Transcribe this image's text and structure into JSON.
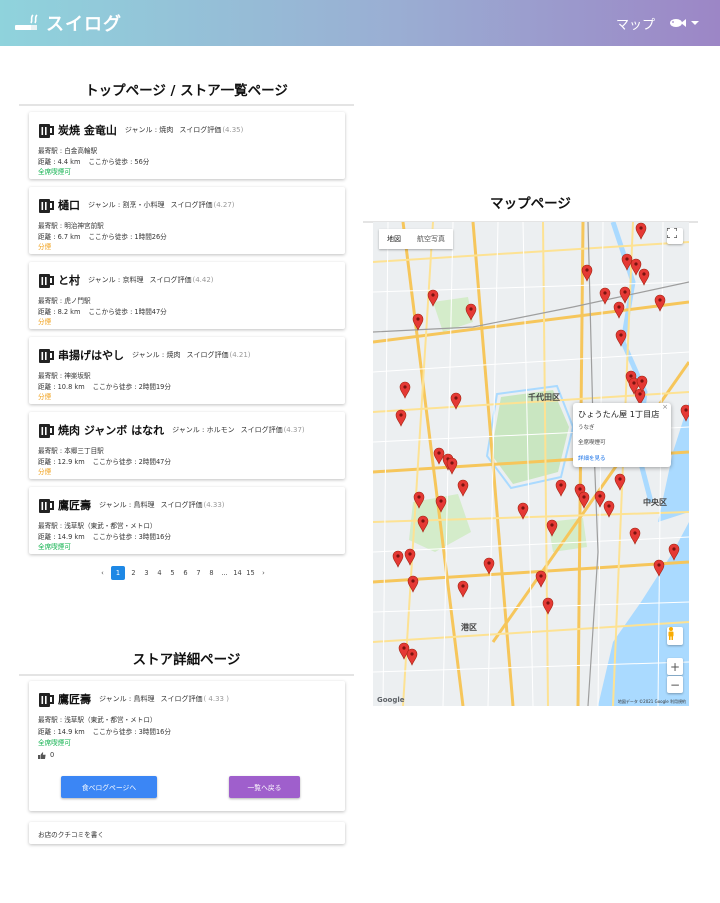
{
  "app": {
    "brand": "スイログ",
    "nav_map": "マップ"
  },
  "top_section": {
    "title": "トップページ / ストア一覧ページ"
  },
  "labels": {
    "genre_prefix": "ジャンル : ",
    "rating_label": "スイログ評価",
    "station_prefix": "最寄駅 : ",
    "distance_prefix": "距離 : ",
    "walk_prefix": "ここから徒歩 : "
  },
  "stores": [
    {
      "name": "炭焼 金竜山",
      "genre": "ジャンル : 焼肉",
      "rating": "(4.35)",
      "station": "最寄駅 : 白金高輪駅",
      "distance": "距離 : 4.4 km",
      "walk": "ここから徒歩 : 56分",
      "smoking": "全席喫煙可",
      "smoking_type": "ok"
    },
    {
      "name": "樋口",
      "genre": "ジャンル : 割烹・小料理",
      "rating": "(4.27)",
      "station": "最寄駅 : 明治神宮前駅",
      "distance": "距離 : 6.7 km",
      "walk": "ここから徒歩 : 1時間26分",
      "smoking": "分煙",
      "smoking_type": "sep"
    },
    {
      "name": "と村",
      "genre": "ジャンル : 京料理",
      "rating": "(4.42)",
      "station": "最寄駅 : 虎ノ門駅",
      "distance": "距離 : 8.2 km",
      "walk": "ここから徒歩 : 1時間47分",
      "smoking": "分煙",
      "smoking_type": "sep"
    },
    {
      "name": "串揚げはやし",
      "genre": "ジャンル : 焼肉",
      "rating": "(4.21)",
      "station": "最寄駅 : 神楽坂駅",
      "distance": "距離 : 10.8 km",
      "walk": "ここから徒歩 : 2時間19分",
      "smoking": "分煙",
      "smoking_type": "sep"
    },
    {
      "name": "焼肉 ジャンボ はなれ",
      "genre": "ジャンル : ホルモン",
      "rating": "(4.37)",
      "station": "最寄駅 : 本郷三丁目駅",
      "distance": "距離 : 12.9 km",
      "walk": "ここから徒歩 : 2時間47分",
      "smoking": "分煙",
      "smoking_type": "sep"
    },
    {
      "name": "鷹匠壽",
      "genre": "ジャンル : 鳥料理",
      "rating": "(4.33)",
      "station": "最寄駅 : 浅草駅（東武・都営・メトロ）",
      "distance": "距離 : 14.9 km",
      "walk": "ここから徒歩 : 3時間16分",
      "smoking": "全席喫煙可",
      "smoking_type": "ok"
    }
  ],
  "pagination": {
    "prev": "‹",
    "pages": [
      "1",
      "2",
      "3",
      "4",
      "5",
      "6",
      "7",
      "8",
      "...",
      "14",
      "15"
    ],
    "current": "1",
    "next": "›"
  },
  "detail_section": {
    "title": "ストア詳細ページ",
    "store": {
      "name": "鷹匠壽",
      "genre": "ジャンル : 鳥料理",
      "rating": "( 4.33 )",
      "station": "最寄駅 : 浅草駅（東武・都営・メトロ）",
      "distance": "距離 : 14.9 km",
      "walk": "ここから徒歩 : 3時間16分",
      "smoking": "全席喫煙可",
      "likes": "0"
    },
    "tabelog_button": "食べログページへ",
    "back_button": "一覧へ戻る",
    "review_link": "お店のクチコミを書く"
  },
  "map_section": {
    "title": "マップページ",
    "map_type_map": "地図",
    "map_type_satellite": "航空写真",
    "zoom_in": "+",
    "zoom_out": "−",
    "districts": {
      "chiyoda": "千代田区",
      "chuo": "中央区",
      "minato": "港区"
    },
    "google": "Google",
    "credit": "地図データ ©2021 Google  利用規約",
    "popup": {
      "name": "ひょうたん屋 1丁目店",
      "genre": "うなぎ",
      "smoking": "全席喫煙可",
      "link": "詳細を見る",
      "close": "×"
    }
  },
  "colors": {
    "nav_start": "#8fd3dc",
    "nav_end": "#9c86c6",
    "primary_btn": "#3b86f5",
    "secondary_btn": "#9f5fcc",
    "smoking_ok": "#10b24e",
    "smoking_sep": "#f0a019",
    "pin": "#e53935"
  },
  "icons": {
    "brand": "cigarette-icon",
    "user": "fish-avatar-icon",
    "store": "beer-mug-icon",
    "like": "thumb-up-icon"
  }
}
